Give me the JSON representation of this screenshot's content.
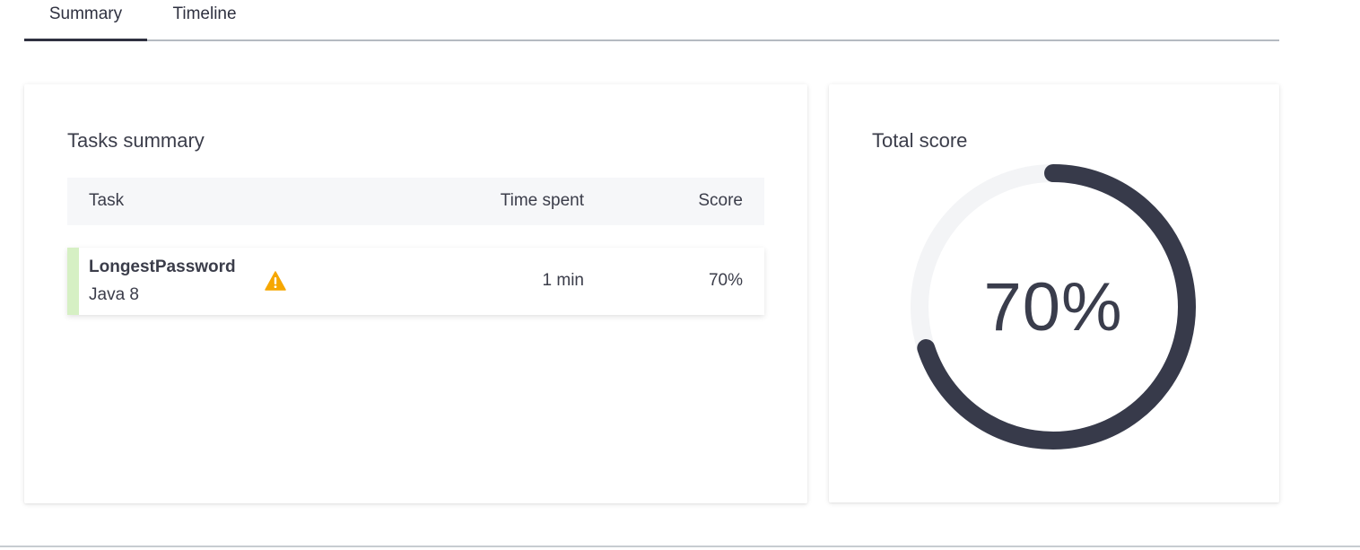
{
  "tabs": [
    {
      "label": "Summary",
      "active": true
    },
    {
      "label": "Timeline",
      "active": false
    }
  ],
  "tasks_card": {
    "title": "Tasks summary",
    "columns": {
      "task": "Task",
      "time": "Time spent",
      "score": "Score"
    },
    "rows": [
      {
        "name": "LongestPassword",
        "language": "Java 8",
        "time_spent": "1 min",
        "score": "70%",
        "status_icon": "warning-icon",
        "accent_color": "#d6f0c4"
      }
    ]
  },
  "score_card": {
    "title": "Total score",
    "value_label": "70%",
    "value": 70,
    "max": 100,
    "ring_color": "#373a4a",
    "track_color": "#f3f4f6"
  },
  "colors": {
    "warning": "#f6a700",
    "text": "#3b3d4a"
  }
}
